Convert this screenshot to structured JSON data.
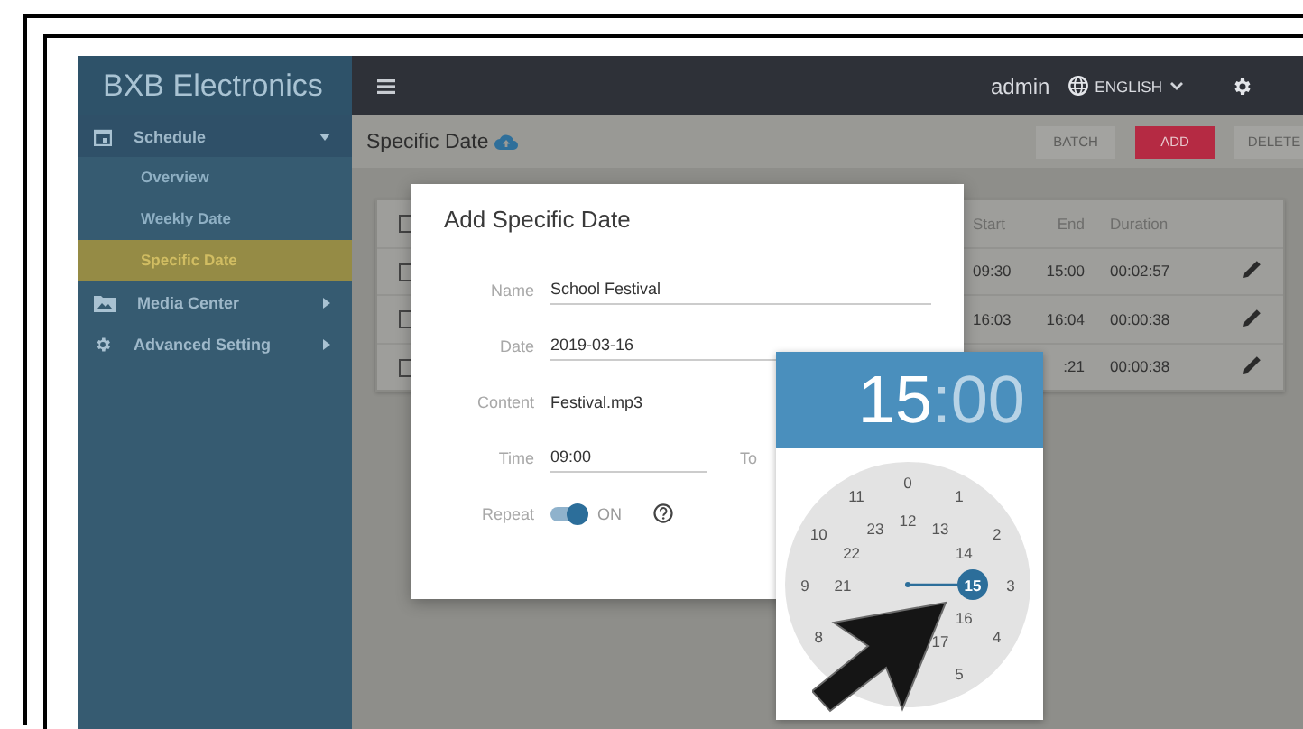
{
  "sidebar": {
    "brand": "BXB Electronics",
    "items": [
      {
        "label": "Schedule",
        "expanded": true,
        "children": [
          {
            "label": "Overview",
            "selected": false
          },
          {
            "label": "Weekly Date",
            "selected": false
          },
          {
            "label": "Specific Date",
            "selected": true
          }
        ]
      },
      {
        "label": "Media Center",
        "expanded": false
      },
      {
        "label": "Advanced Setting",
        "expanded": false
      }
    ]
  },
  "topbar": {
    "user": "admin",
    "language": "ENGLISH"
  },
  "page": {
    "title": "Specific Date",
    "buttons": [
      {
        "label": "BATCH",
        "kind": "default",
        "disabled": true
      },
      {
        "label": "ADD",
        "kind": "primary",
        "disabled": false
      },
      {
        "label": "DELETE",
        "kind": "default",
        "disabled": true
      }
    ]
  },
  "table": {
    "header_checked": false,
    "columns": [
      "Start",
      "End",
      "Duration"
    ],
    "rows": [
      {
        "checked": false,
        "start": "09:30",
        "end": "15:00",
        "duration": "00:02:57"
      },
      {
        "checked": false,
        "start": "16:03",
        "end": "16:04",
        "duration": "00:00:38"
      },
      {
        "checked": false,
        "end": ":21",
        "duration": "00:00:38"
      }
    ]
  },
  "dialog": {
    "title": "Add Specific Date",
    "fields": [
      {
        "kind": "input",
        "label": "Name",
        "value": "School Festival"
      },
      {
        "kind": "input",
        "label": "Date",
        "value": "2019-03-16"
      },
      {
        "kind": "text",
        "label": "Content",
        "value": "Festival.mp3"
      },
      {
        "kind": "range",
        "label": "Time",
        "value": "09:00",
        "to_label": "To"
      },
      {
        "kind": "toggle",
        "label": "Repeat",
        "on": true,
        "value": "ON"
      }
    ]
  },
  "time_picker": {
    "hours": "15",
    "separator": ":",
    "minutes": "00",
    "outer_ring": [
      {
        "label": "8",
        "selected": false
      },
      {
        "label": "9",
        "selected": false
      },
      {
        "label": "10",
        "selected": false
      },
      {
        "label": "11",
        "selected": false
      },
      {
        "label": "0",
        "selected": false
      },
      {
        "label": "1",
        "selected": false
      },
      {
        "label": "2",
        "selected": false
      },
      {
        "label": "3",
        "selected": false
      },
      {
        "label": "4",
        "selected": false
      },
      {
        "label": "5",
        "selected": false
      }
    ],
    "inner_ring": [
      {
        "label": "21",
        "selected": false
      },
      {
        "label": "22",
        "selected": false
      },
      {
        "label": "23",
        "selected": false
      },
      {
        "label": "12",
        "selected": false
      },
      {
        "label": "13",
        "selected": false
      },
      {
        "label": "14",
        "selected": false
      },
      {
        "label": "15",
        "selected": true
      },
      {
        "label": "16",
        "selected": false
      },
      {
        "label": "17",
        "selected": false
      }
    ]
  }
}
